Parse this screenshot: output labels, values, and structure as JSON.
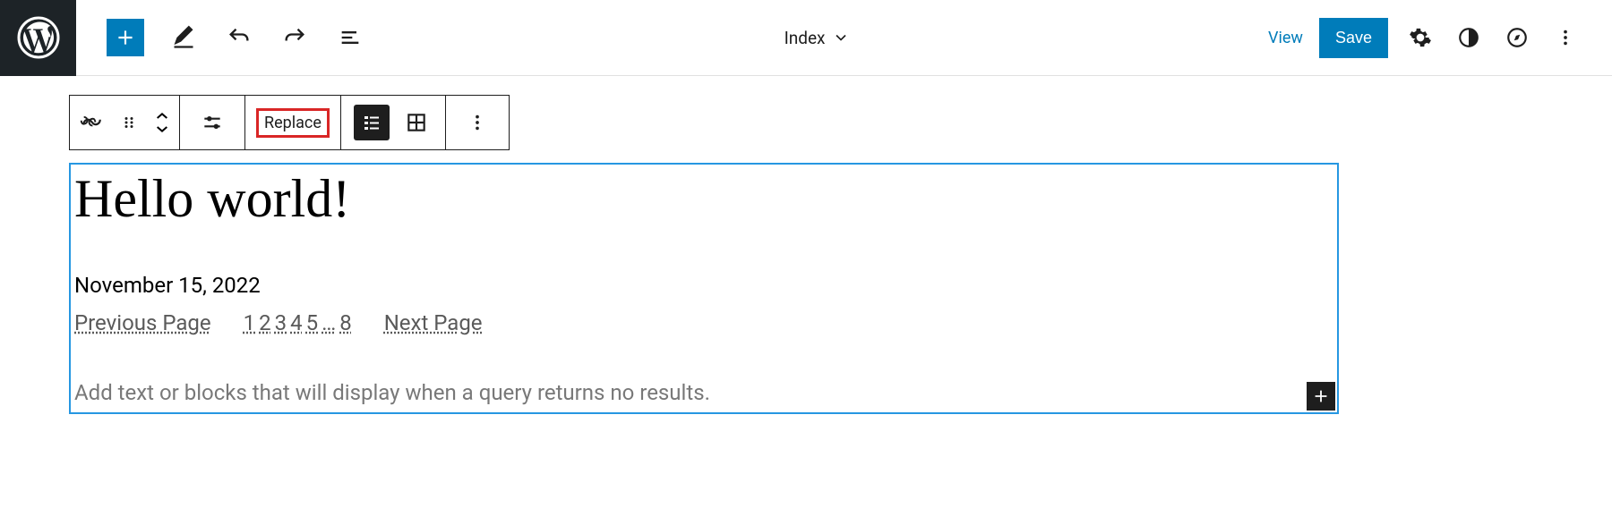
{
  "topbar": {
    "document_title": "Index",
    "view_label": "View",
    "save_label": "Save"
  },
  "block_toolbar": {
    "replace_label": "Replace"
  },
  "post": {
    "title": "Hello world!",
    "date": "November 15, 2022"
  },
  "pagination": {
    "prev": "Previous Page",
    "next": "Next Page",
    "pages": [
      "1",
      "2",
      "3",
      "4",
      "5",
      "…",
      "8"
    ]
  },
  "placeholder_text": "Add text or blocks that will display when a query returns no results."
}
